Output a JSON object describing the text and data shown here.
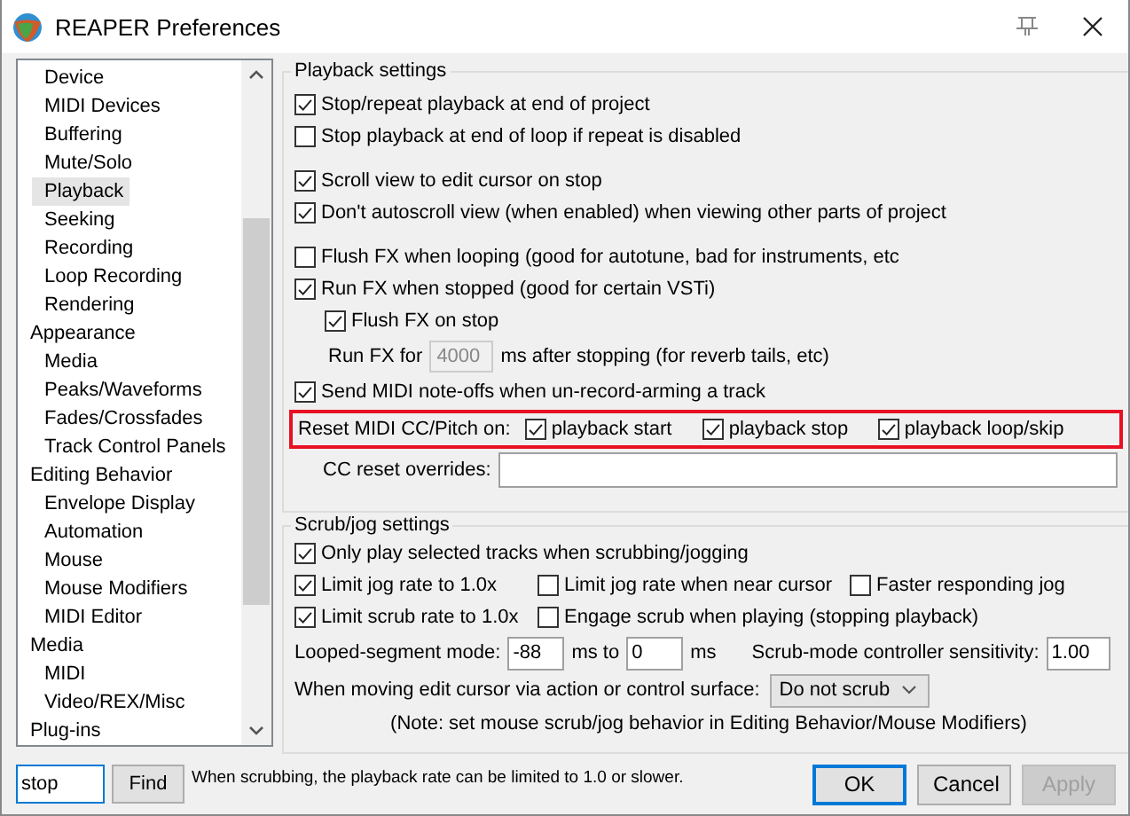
{
  "window": {
    "title": "REAPER Preferences"
  },
  "sidebar": {
    "continued_children": [
      {
        "label": "Device",
        "selected": false
      },
      {
        "label": "MIDI Devices",
        "selected": false
      },
      {
        "label": "Buffering",
        "selected": false
      },
      {
        "label": "Mute/Solo",
        "selected": false
      },
      {
        "label": "Playback",
        "selected": true
      },
      {
        "label": "Seeking",
        "selected": false
      },
      {
        "label": "Recording",
        "selected": false
      },
      {
        "label": "Loop Recording",
        "selected": false
      },
      {
        "label": "Rendering",
        "selected": false
      }
    ],
    "items": [
      {
        "label": "Appearance",
        "selected": false,
        "children": [
          {
            "label": "Media",
            "selected": false
          },
          {
            "label": "Peaks/Waveforms",
            "selected": false
          },
          {
            "label": "Fades/Crossfades",
            "selected": false
          },
          {
            "label": "Track Control Panels",
            "selected": false
          }
        ]
      },
      {
        "label": "Editing Behavior",
        "selected": false,
        "children": [
          {
            "label": "Envelope Display",
            "selected": false
          },
          {
            "label": "Automation",
            "selected": false
          },
          {
            "label": "Mouse",
            "selected": false
          },
          {
            "label": "Mouse Modifiers",
            "selected": false
          },
          {
            "label": "MIDI Editor",
            "selected": false
          }
        ]
      },
      {
        "label": "Media",
        "selected": false,
        "children": [
          {
            "label": "MIDI",
            "selected": false
          },
          {
            "label": "Video/REX/Misc",
            "selected": false
          }
        ]
      },
      {
        "label": "Plug-ins",
        "selected": false
      }
    ]
  },
  "playback": {
    "title": "Playback settings",
    "sections": [
      [
        {
          "label": "Stop/repeat playback at end of project",
          "checked": true
        },
        {
          "label": "Stop playback at end of loop if repeat is disabled",
          "checked": false
        }
      ],
      [
        {
          "label": "Scroll view to edit cursor on stop",
          "checked": true
        },
        {
          "label": "Don't autoscroll view (when enabled) when viewing other parts of project",
          "checked": true
        }
      ],
      [
        {
          "label": "Flush FX when looping (good for autotune, bad for instruments, etc",
          "checked": false
        },
        {
          "label": "Run FX when stopped (good for certain VSTi)",
          "checked": true,
          "children": [
            {
              "kind": "checkbox",
              "label": "Flush FX on stop",
              "checked": true
            },
            {
              "kind": "number",
              "label": "Run FX for",
              "value": "4000",
              "disabled": true,
              "suffix": "ms after stopping (for reverb tails, etc)"
            }
          ]
        },
        {
          "label": "Send MIDI note-offs when un-record-arming a track",
          "checked": true
        }
      ]
    ],
    "reset": {
      "label": "Reset MIDI CC/Pitch on:",
      "highlighted": true,
      "options": [
        {
          "label": "playback start",
          "checked": true
        },
        {
          "label": "playback stop",
          "checked": true
        },
        {
          "label": "playback loop/skip",
          "checked": true
        }
      ]
    },
    "overrides": {
      "label": "CC reset overrides:"
    }
  },
  "scrub": {
    "title": "Scrub/jog settings",
    "rows": [
      [
        {
          "label": "Only play selected tracks when scrubbing/jogging",
          "checked": true
        }
      ],
      [
        {
          "label": "Limit jog rate to 1.0x",
          "checked": true
        },
        {
          "label": "Limit jog rate when near cursor",
          "checked": false
        },
        {
          "label": "Faster responding jog",
          "checked": false
        }
      ],
      [
        {
          "label": "Limit scrub rate to 1.0x",
          "checked": true
        },
        {
          "label": "Engage scrub when playing (stopping playback)",
          "checked": false
        }
      ]
    ],
    "looped": {
      "label": "Looped-segment mode:",
      "from": "-88",
      "between": "ms to",
      "to": "0",
      "unit": "ms",
      "sensitivity_label": "Scrub-mode controller sensitivity:",
      "sensitivity": "1.00"
    },
    "edit_cursor": {
      "label": "When moving edit cursor via action or control surface:",
      "value": "Do not scrub"
    },
    "note": "(Note: set mouse scrub/jog behavior in Editing Behavior/Mouse Modifiers)"
  },
  "footer": {
    "search": "stop",
    "find": "Find",
    "hint": "When scrubbing, the playback rate can be limited to 1.0 or slower.",
    "buttons": [
      {
        "label": "OK",
        "default": true,
        "disabled": false
      },
      {
        "label": "Cancel",
        "default": false,
        "disabled": false
      },
      {
        "label": "Apply",
        "default": false,
        "disabled": true
      }
    ]
  }
}
